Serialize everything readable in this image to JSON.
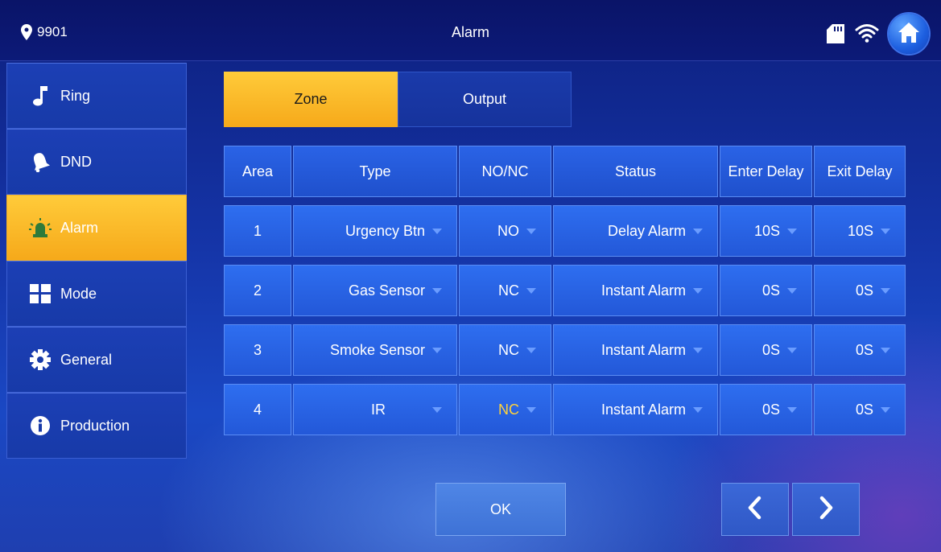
{
  "header": {
    "location_text": "9901",
    "title": "Alarm",
    "icons": [
      "location-pin-icon",
      "sd-card-icon",
      "wifi-icon",
      "home-icon"
    ]
  },
  "sidebar": {
    "items": [
      {
        "label": "Ring",
        "icon": "music-note-icon",
        "active": false
      },
      {
        "label": "DND",
        "icon": "bell-icon",
        "active": false
      },
      {
        "label": "Alarm",
        "icon": "alarm-light-icon",
        "active": true
      },
      {
        "label": "Mode",
        "icon": "grid-icon",
        "active": false
      },
      {
        "label": "General",
        "icon": "gear-icon",
        "active": false
      },
      {
        "label": "Production",
        "icon": "info-icon",
        "active": false
      }
    ]
  },
  "tabs": [
    {
      "label": "Zone",
      "active": true
    },
    {
      "label": "Output",
      "active": false
    }
  ],
  "table": {
    "headers": [
      "Area",
      "Type",
      "NO/NC",
      "Status",
      "Enter Delay",
      "Exit Delay"
    ],
    "rows": [
      {
        "area": "1",
        "type": "Urgency Btn",
        "nonc": "NO",
        "status": "Delay Alarm",
        "enter_delay": "10S",
        "exit_delay": "10S"
      },
      {
        "area": "2",
        "type": "Gas Sensor",
        "nonc": "NC",
        "status": "Instant Alarm",
        "enter_delay": "0S",
        "exit_delay": "0S"
      },
      {
        "area": "3",
        "type": "Smoke Sensor",
        "nonc": "NC",
        "status": "Instant Alarm",
        "enter_delay": "0S",
        "exit_delay": "0S"
      },
      {
        "area": "4",
        "type": "IR",
        "nonc": "NC",
        "status": "Instant Alarm",
        "enter_delay": "0S",
        "exit_delay": "0S"
      }
    ]
  },
  "footer": {
    "ok_label": "OK",
    "prev_icon": "chevron-left-icon",
    "next_icon": "chevron-right-icon"
  },
  "colors": {
    "accent": "#f6a91a",
    "header_bg": "#0c1a78",
    "cell_bg": "#2e6ef0",
    "highlight_text": "#ffd23a"
  }
}
